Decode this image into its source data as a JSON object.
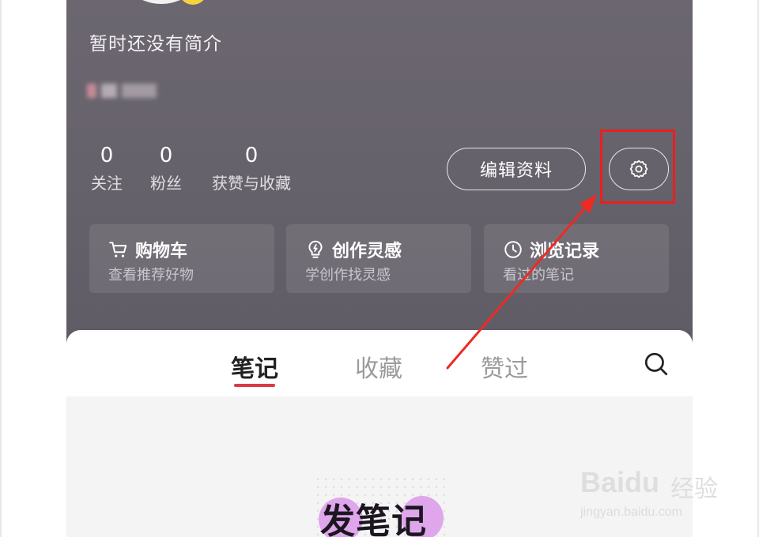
{
  "profile": {
    "bio": "暂时还没有简介",
    "stats": [
      {
        "value": "0",
        "label": "关注"
      },
      {
        "value": "0",
        "label": "粉丝"
      },
      {
        "value": "0",
        "label": "获赞与收藏"
      }
    ],
    "edit_label": "编辑资料"
  },
  "cards": [
    {
      "title": "购物车",
      "subtitle": "查看推荐好物",
      "icon": "cart-icon"
    },
    {
      "title": "创作灵感",
      "subtitle": "学创作找灵感",
      "icon": "lightbulb-icon"
    },
    {
      "title": "浏览记录",
      "subtitle": "看过的笔记",
      "icon": "clock-icon"
    }
  ],
  "tabs": [
    {
      "label": "笔记",
      "active": true
    },
    {
      "label": "收藏",
      "active": false
    },
    {
      "label": "赞过",
      "active": false
    }
  ],
  "empty_state": {
    "label": "发笔记"
  },
  "watermark": {
    "brand": "Baidu",
    "text": "经验",
    "url": "jingyan.baidu.com"
  },
  "colors": {
    "highlight": "#e8201f",
    "tab_underline": "#d93a45",
    "profile_bg": "#66626b"
  }
}
